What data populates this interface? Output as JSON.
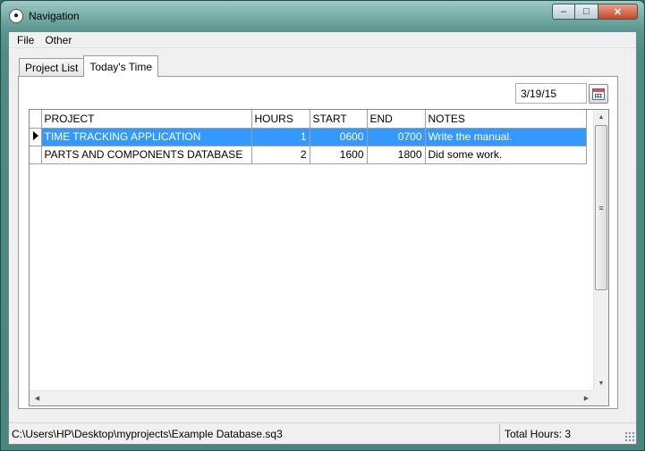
{
  "window": {
    "title": "Navigation",
    "minimize_glyph": "–",
    "maximize_glyph": "□",
    "close_glyph": "✕",
    "app_icon": "paw-icon"
  },
  "menu": {
    "items": [
      "File",
      "Other"
    ]
  },
  "tabs": [
    {
      "label": "Project List",
      "active": false
    },
    {
      "label": "Today's Time",
      "active": true
    }
  ],
  "date_picker": {
    "value": "3/19/15",
    "icon": "calendar-icon"
  },
  "grid": {
    "columns": [
      "PROJECT",
      "HOURS",
      "START",
      "END",
      "NOTES"
    ],
    "rows": [
      {
        "project": "TIME TRACKING APPLICATION",
        "hours": "1",
        "start": "0600",
        "end": "0700",
        "notes": "Write the manual.",
        "selected": true
      },
      {
        "project": "PARTS AND COMPONENTS DATABASE",
        "hours": "2",
        "start": "1600",
        "end": "1800",
        "notes": "Did some work.",
        "selected": false
      }
    ]
  },
  "statusbar": {
    "path": "C:\\Users\\HP\\Desktop\\myprojects\\Example Database.sq3",
    "total_hours": "Total Hours: 3"
  },
  "colors": {
    "selection": "#3399ff",
    "titlebar": "#5d9690"
  }
}
